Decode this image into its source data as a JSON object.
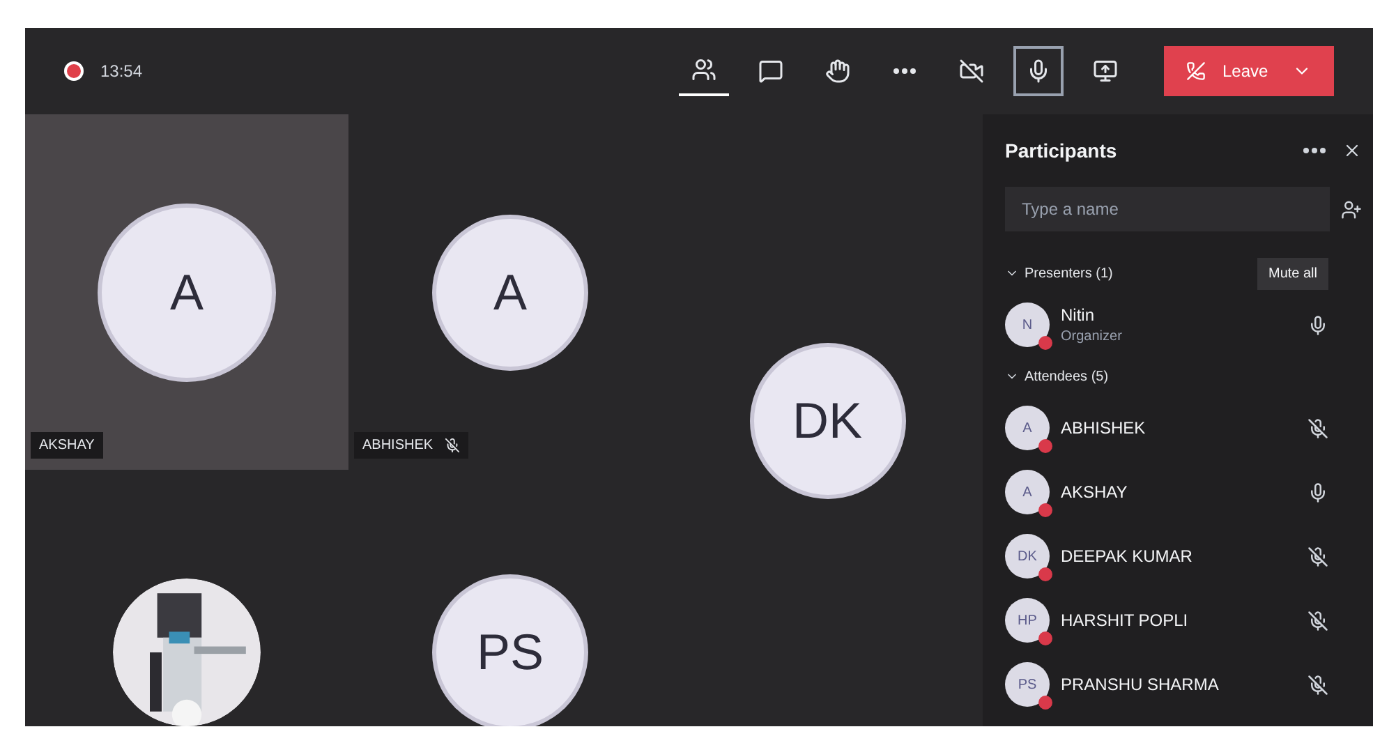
{
  "meeting": {
    "timer": "13:54"
  },
  "toolbar": {
    "buttons": [
      {
        "kind": "people",
        "selected": true
      },
      {
        "kind": "chat",
        "selected": false
      },
      {
        "kind": "hand",
        "selected": false
      },
      {
        "kind": "more",
        "selected": false
      },
      {
        "kind": "camera",
        "selected": false
      },
      {
        "kind": "mic",
        "selected": true
      },
      {
        "kind": "share",
        "selected": false
      }
    ],
    "leave": "Leave"
  },
  "tiles": [
    {
      "initials": "A",
      "name": "AKSHAY",
      "muted": false,
      "kind": "initials"
    },
    {
      "initials": "A",
      "name": "ABHISHEK",
      "muted": true,
      "kind": "initials"
    },
    {
      "initials": "DK",
      "kind": "initials"
    },
    {
      "kind": "picture"
    },
    {
      "initials": "PS",
      "kind": "initials"
    }
  ],
  "participants": {
    "title": "Participants",
    "search": {
      "placeholder": "Type a name"
    },
    "groups": [
      {
        "label": "Presenters (1)",
        "action": "Mute all",
        "people": [
          {
            "initials": "N",
            "name": "Nitin",
            "role": "Organizer",
            "muted": false
          }
        ]
      },
      {
        "label": "Attendees (5)",
        "people": [
          {
            "initials": "A",
            "name": "ABHISHEK",
            "muted": true
          },
          {
            "initials": "A",
            "name": "AKSHAY",
            "muted": false
          },
          {
            "initials": "DK",
            "name": "DEEPAK KUMAR",
            "muted": true
          },
          {
            "initials": "HP",
            "name": "HARSHIT POPLI",
            "muted": true
          },
          {
            "initials": "PS",
            "name": "PRANSHU SHARMA",
            "muted": true
          }
        ]
      }
    ]
  }
}
